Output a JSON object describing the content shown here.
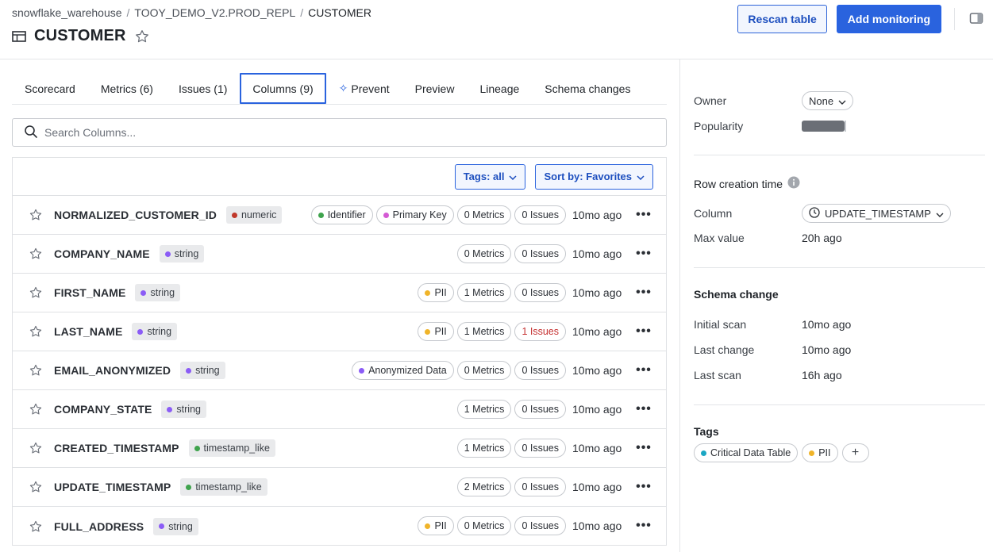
{
  "breadcrumb": {
    "items": [
      "snowflake_warehouse",
      "TOOY_DEMO_V2.PROD_REPL",
      "CUSTOMER"
    ],
    "separator": "/"
  },
  "page": {
    "title": "CUSTOMER"
  },
  "header": {
    "rescan_label": "Rescan table",
    "add_monitoring_label": "Add monitoring"
  },
  "tabs": [
    {
      "label": "Scorecard"
    },
    {
      "label": "Metrics (6)"
    },
    {
      "label": "Issues (1)"
    },
    {
      "label": "Columns (9)",
      "active": true
    },
    {
      "label": "Prevent",
      "icon": "sparkle-icon"
    },
    {
      "label": "Preview"
    },
    {
      "label": "Lineage"
    },
    {
      "label": "Schema changes"
    }
  ],
  "search": {
    "placeholder": "Search Columns..."
  },
  "toolbar": {
    "tags_filter": "Tags: all",
    "sort_by": "Sort by: Favorites"
  },
  "colors": {
    "accent": "#2a63de",
    "numeric_dot": "#c0392b",
    "string_dot": "#8b5cf6",
    "timestamp_dot": "#3fa34d",
    "identifier_dot": "#3fa34d",
    "primary_key_dot": "#d45ad4",
    "pii_dot": "#f0b429",
    "anonymized_dot": "#8b5cf6",
    "critical_dot": "#1ba7c4",
    "issue_red": "#c53030"
  },
  "columns": [
    {
      "name": "NORMALIZED_CUSTOMER_ID",
      "type": "numeric",
      "type_color": "#c0392b",
      "tags": [
        {
          "label": "Identifier",
          "color": "#3fa34d"
        },
        {
          "label": "Primary Key",
          "color": "#d45ad4"
        }
      ],
      "metrics": "0 Metrics",
      "issues": "0 Issues",
      "issues_alert": false,
      "time": "10mo ago"
    },
    {
      "name": "COMPANY_NAME",
      "type": "string",
      "type_color": "#8b5cf6",
      "tags": [],
      "metrics": "0 Metrics",
      "issues": "0 Issues",
      "issues_alert": false,
      "time": "10mo ago"
    },
    {
      "name": "FIRST_NAME",
      "type": "string",
      "type_color": "#8b5cf6",
      "tags": [
        {
          "label": "PII",
          "color": "#f0b429"
        }
      ],
      "metrics": "1 Metrics",
      "issues": "0 Issues",
      "issues_alert": false,
      "time": "10mo ago"
    },
    {
      "name": "LAST_NAME",
      "type": "string",
      "type_color": "#8b5cf6",
      "tags": [
        {
          "label": "PII",
          "color": "#f0b429"
        }
      ],
      "metrics": "1 Metrics",
      "issues": "1 Issues",
      "issues_alert": true,
      "time": "10mo ago"
    },
    {
      "name": "EMAIL_ANONYMIZED",
      "type": "string",
      "type_color": "#8b5cf6",
      "tags": [
        {
          "label": "Anonymized Data",
          "color": "#8b5cf6"
        }
      ],
      "metrics": "0 Metrics",
      "issues": "0 Issues",
      "issues_alert": false,
      "time": "10mo ago"
    },
    {
      "name": "COMPANY_STATE",
      "type": "string",
      "type_color": "#8b5cf6",
      "tags": [],
      "metrics": "1 Metrics",
      "issues": "0 Issues",
      "issues_alert": false,
      "time": "10mo ago"
    },
    {
      "name": "CREATED_TIMESTAMP",
      "type": "timestamp_like",
      "type_color": "#3fa34d",
      "tags": [],
      "metrics": "1 Metrics",
      "issues": "0 Issues",
      "issues_alert": false,
      "time": "10mo ago"
    },
    {
      "name": "UPDATE_TIMESTAMP",
      "type": "timestamp_like",
      "type_color": "#3fa34d",
      "tags": [],
      "metrics": "2 Metrics",
      "issues": "0 Issues",
      "issues_alert": false,
      "time": "10mo ago"
    },
    {
      "name": "FULL_ADDRESS",
      "type": "string",
      "type_color": "#8b5cf6",
      "tags": [
        {
          "label": "PII",
          "color": "#f0b429"
        }
      ],
      "metrics": "0 Metrics",
      "issues": "0 Issues",
      "issues_alert": false,
      "time": "10mo ago"
    }
  ],
  "side": {
    "owner_label": "Owner",
    "owner_value": "None",
    "popularity_label": "Popularity",
    "row_creation_title": "Row creation time",
    "column_label": "Column",
    "column_value": "UPDATE_TIMESTAMP",
    "max_value_label": "Max value",
    "max_value": "20h ago",
    "schema_change_title": "Schema change",
    "initial_scan_label": "Initial scan",
    "initial_scan_value": "10mo ago",
    "last_change_label": "Last change",
    "last_change_value": "10mo ago",
    "last_scan_label": "Last scan",
    "last_scan_value": "16h ago",
    "tags_title": "Tags",
    "tags": [
      {
        "label": "Critical Data Table",
        "color": "#1ba7c4"
      },
      {
        "label": "PII",
        "color": "#f0b429"
      }
    ],
    "add_tag": "+"
  }
}
